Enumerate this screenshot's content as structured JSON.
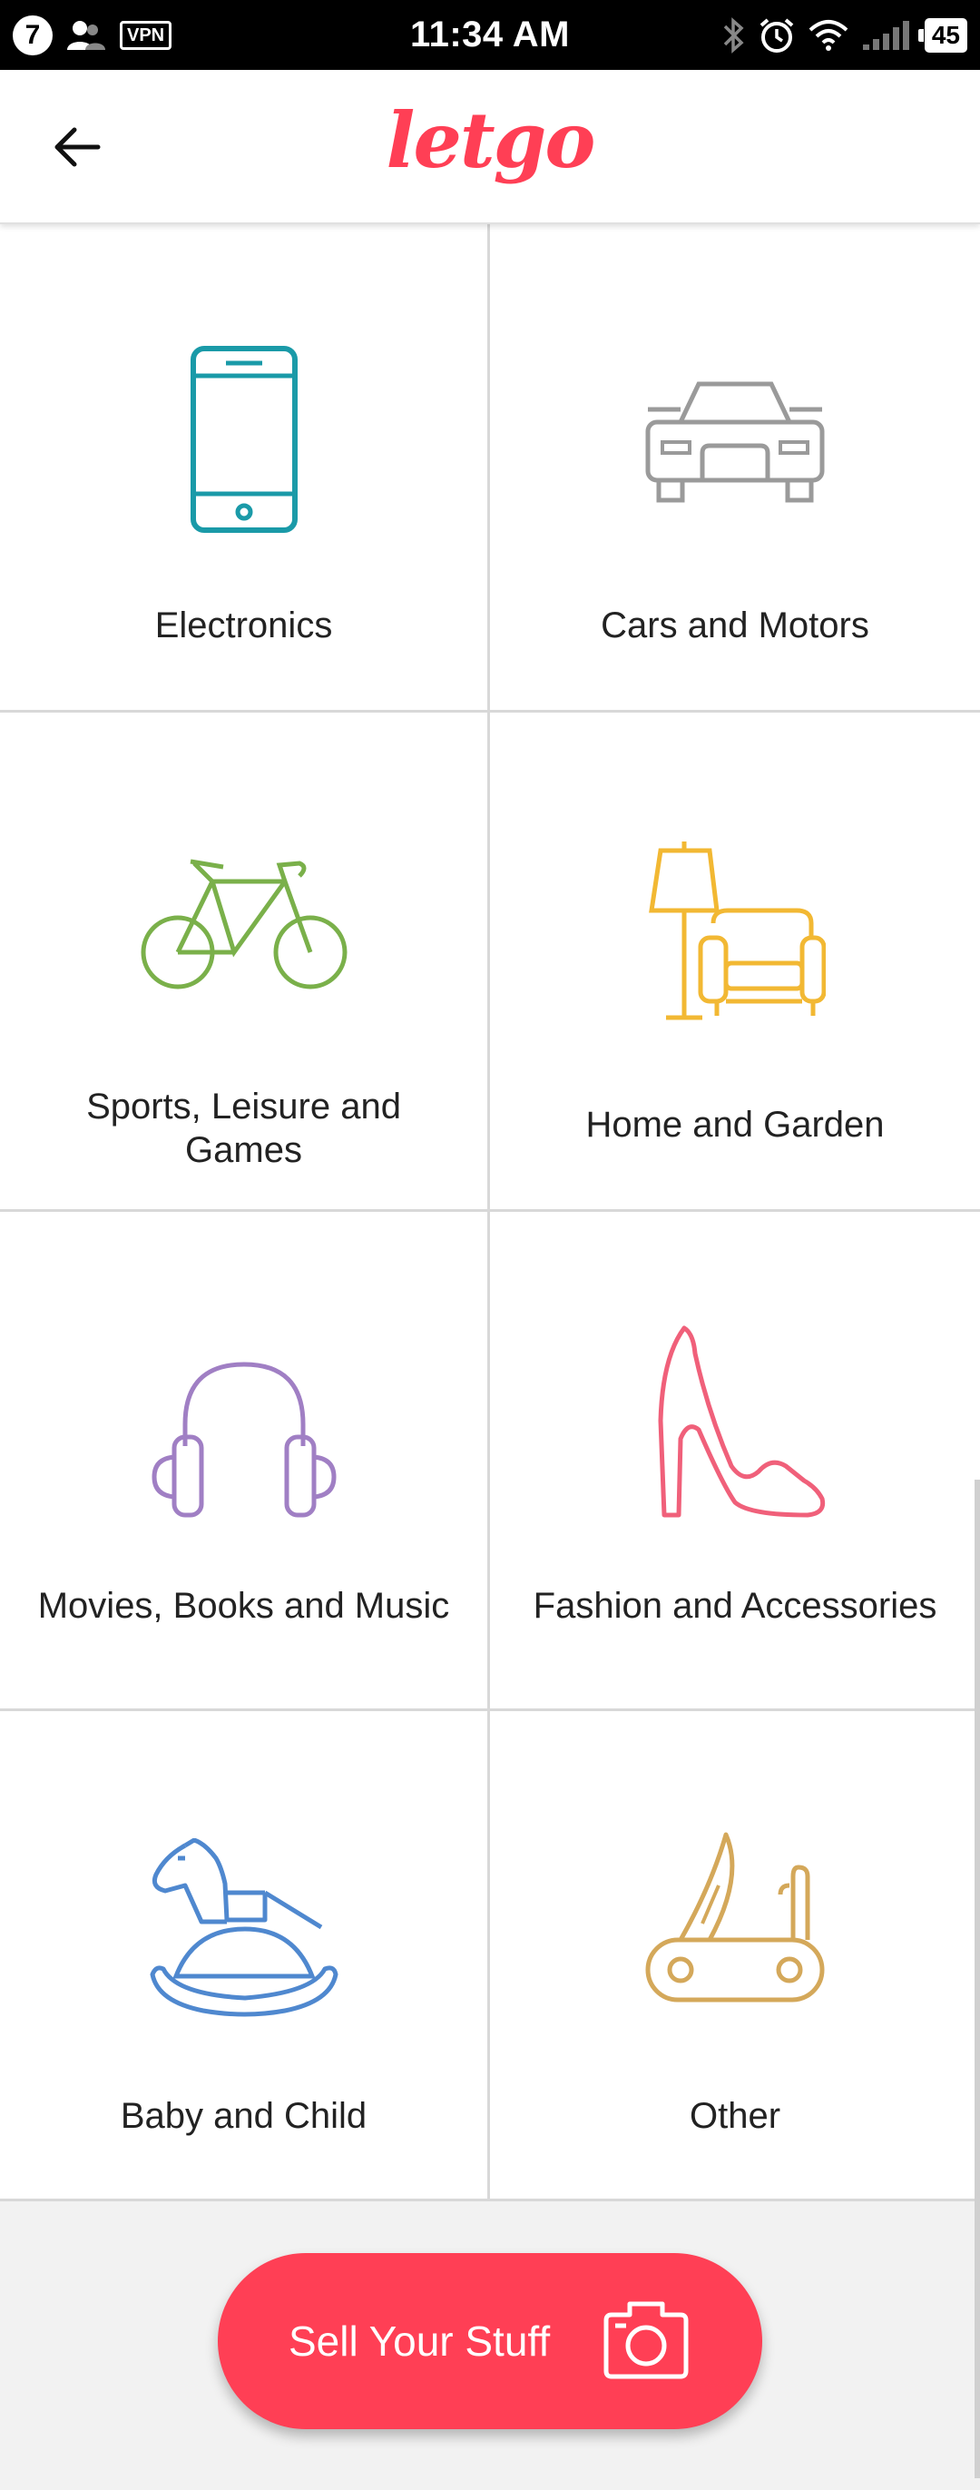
{
  "status_bar": {
    "notification_count": "7",
    "vpn_label": "VPN",
    "time": "11:34 AM",
    "battery": "45"
  },
  "app_bar": {
    "logo_text": "letgo"
  },
  "categories": [
    {
      "label": "Electronics",
      "icon": "smartphone-icon",
      "color": "#1a9aa8"
    },
    {
      "label": "Cars and Motors",
      "icon": "car-icon",
      "color": "#9a9a9a"
    },
    {
      "label": "Sports, Leisure and Games",
      "icon": "bicycle-icon",
      "color": "#7ab04a"
    },
    {
      "label": "Home and Garden",
      "icon": "lamp-armchair-icon",
      "color": "#f2b833"
    },
    {
      "label": "Movies, Books and Music",
      "icon": "headphones-icon",
      "color": "#a07fc4"
    },
    {
      "label": "Fashion and Accessories",
      "icon": "high-heel-icon",
      "color": "#f0607a"
    },
    {
      "label": "Baby and Child",
      "icon": "rocking-horse-icon",
      "color": "#4f88cf"
    },
    {
      "label": "Other",
      "icon": "pocket-knife-icon",
      "color": "#d4a85a"
    }
  ],
  "sell_button": {
    "label": "Sell Your Stuff",
    "icon": "camera-icon"
  },
  "colors": {
    "brand": "#ff3f55"
  }
}
